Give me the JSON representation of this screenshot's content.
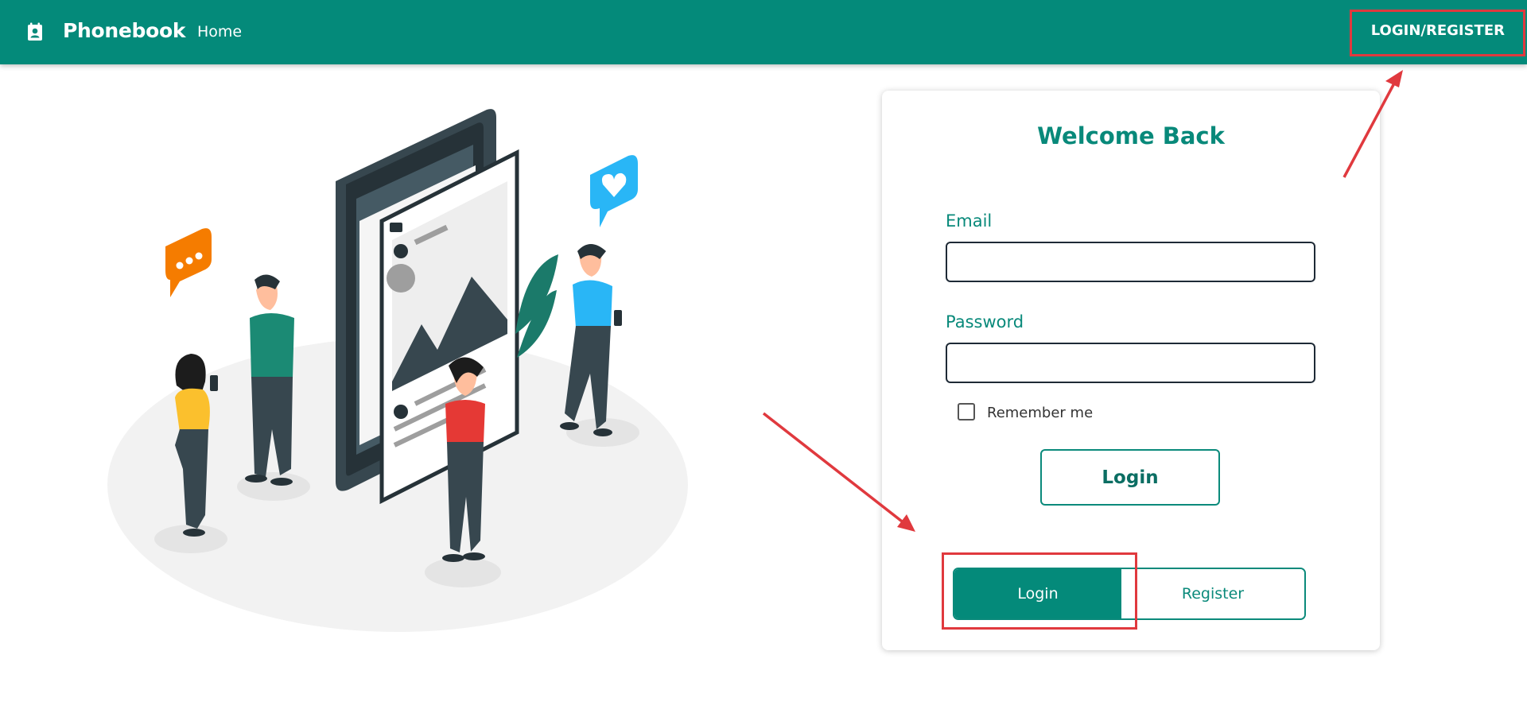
{
  "navbar": {
    "brand": "Phonebook",
    "brand_icon": "contact-book-icon",
    "home": "Home",
    "auth": "LOGIN/REGISTER",
    "color": "#048a7a"
  },
  "illustration": {
    "icons": [
      "chat-bubble-icon",
      "heart-notification-icon",
      "camera-icon",
      "image-icon"
    ]
  },
  "login_card": {
    "title": "Welcome Back",
    "email_label": "Email",
    "email_value": "",
    "password_label": "Password",
    "password_value": "",
    "remember_label": "Remember me",
    "remember_checked": false,
    "submit_label": "Login"
  },
  "mode_toggle": {
    "login_label": "Login",
    "register_label": "Register",
    "selected": "Login"
  },
  "annotations": {
    "color": "#e0393e"
  }
}
